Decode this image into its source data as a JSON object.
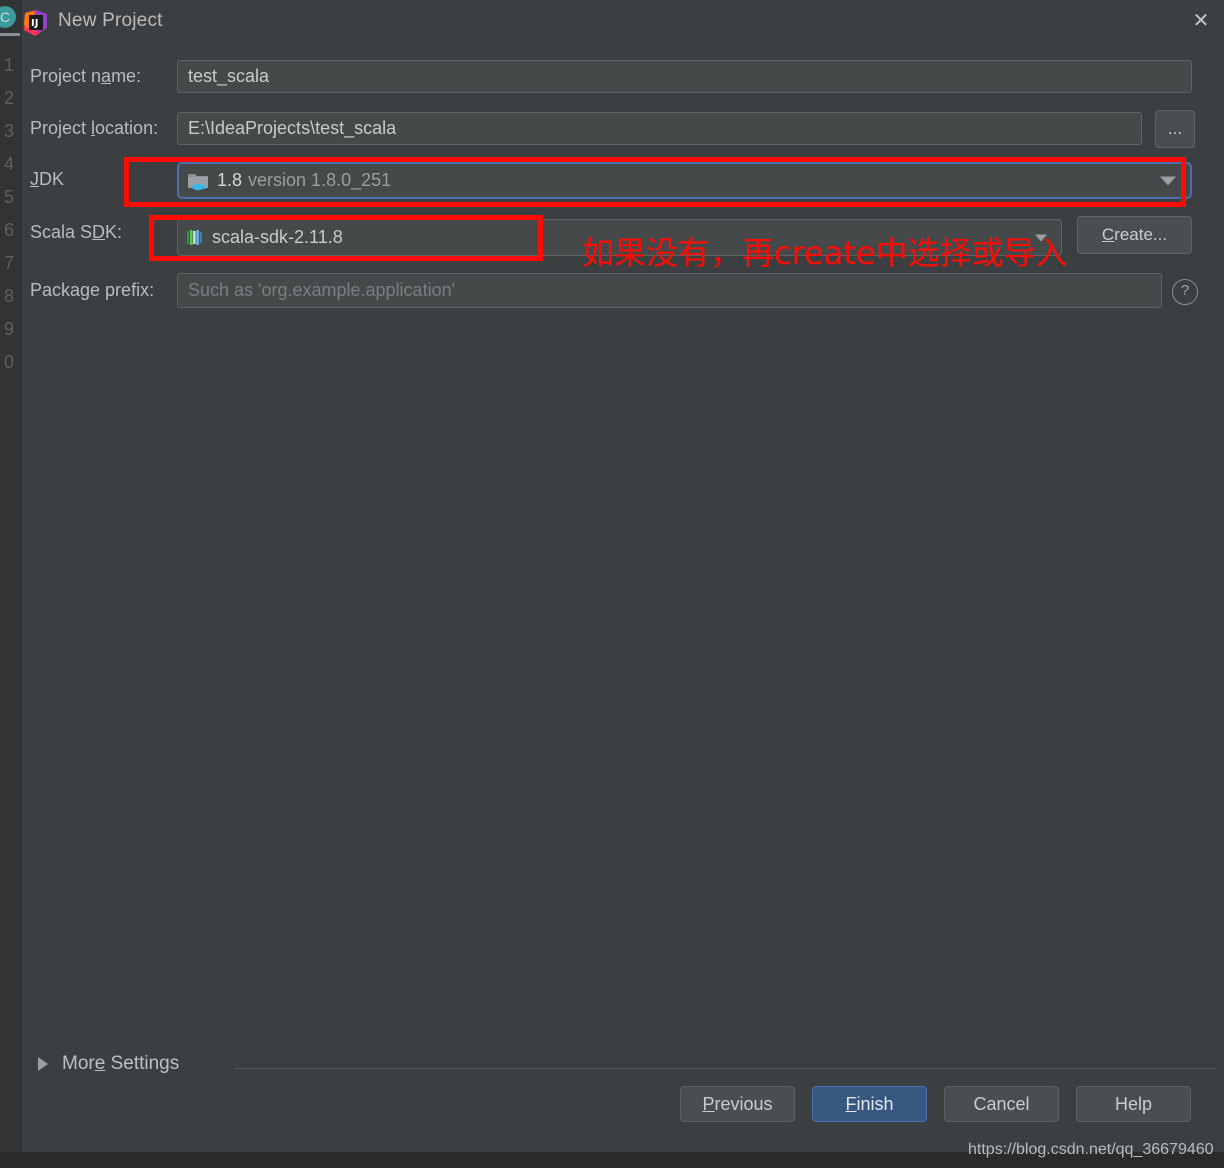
{
  "window": {
    "title": "New Project",
    "logo_icon": "intellij-idea-logo",
    "close_icon": "close-icon"
  },
  "editor_gutter": {
    "tab_chip_letter": "C",
    "line_numbers": [
      "1",
      "2",
      "3",
      "4",
      "5",
      "6",
      "7",
      "8",
      "9",
      "0"
    ]
  },
  "form": {
    "project_name": {
      "label_pre": "Project n",
      "label_mnemonic": "a",
      "label_post": "me:",
      "value": "test_scala"
    },
    "project_location": {
      "label_pre": "Project ",
      "label_mnemonic": "l",
      "label_post": "ocation:",
      "value": "E:\\IdeaProjects\\test_scala",
      "browse_label": "..."
    },
    "jdk": {
      "label_pre": "",
      "label_mnemonic": "J",
      "label_post": "DK",
      "icon": "jdk-folder-icon",
      "value_main": "1.8",
      "value_sub": "version 1.8.0_251"
    },
    "scala_sdk": {
      "label_pre": "Scala S",
      "label_mnemonic": "D",
      "label_post": "K:",
      "icon": "scala-library-icon",
      "value": "scala-sdk-2.11.8",
      "create_button": {
        "label_pre": "",
        "label_mnemonic": "C",
        "label_post": "reate..."
      }
    },
    "package_prefix": {
      "label": "Package prefix:",
      "placeholder": "Such as 'org.example.application'",
      "value": "",
      "help_icon": "question-mark-icon"
    }
  },
  "annotation": {
    "text": "如果没有，再create中选择或导入",
    "color": "#fb0d06"
  },
  "more_settings": {
    "label_pre": "Mor",
    "label_mnemonic": "e",
    "label_post": " Settings",
    "expand_icon": "triangle-right-icon"
  },
  "footer": {
    "buttons": [
      {
        "name": "previous",
        "pre": "",
        "mnemonic": "P",
        "post": "revious",
        "primary": false
      },
      {
        "name": "finish",
        "pre": "",
        "mnemonic": "F",
        "post": "inish",
        "primary": true
      },
      {
        "name": "cancel",
        "pre": "Cancel",
        "mnemonic": "",
        "post": "",
        "primary": false
      },
      {
        "name": "help",
        "pre": "Help",
        "mnemonic": "",
        "post": "",
        "primary": false
      }
    ],
    "buttons_flat": {
      "previous": "Previous",
      "finish": "Finish",
      "cancel": "Cancel",
      "help": "Help"
    }
  },
  "watermark": {
    "url": "https://blog.csdn.net/qq_36679460"
  },
  "colors": {
    "dialog_bg": "#3c3f41",
    "field_bg": "#45494a",
    "accent_focus": "#4b6eaf",
    "primary_button": "#365880",
    "annotation_red": "#fb0d06"
  }
}
